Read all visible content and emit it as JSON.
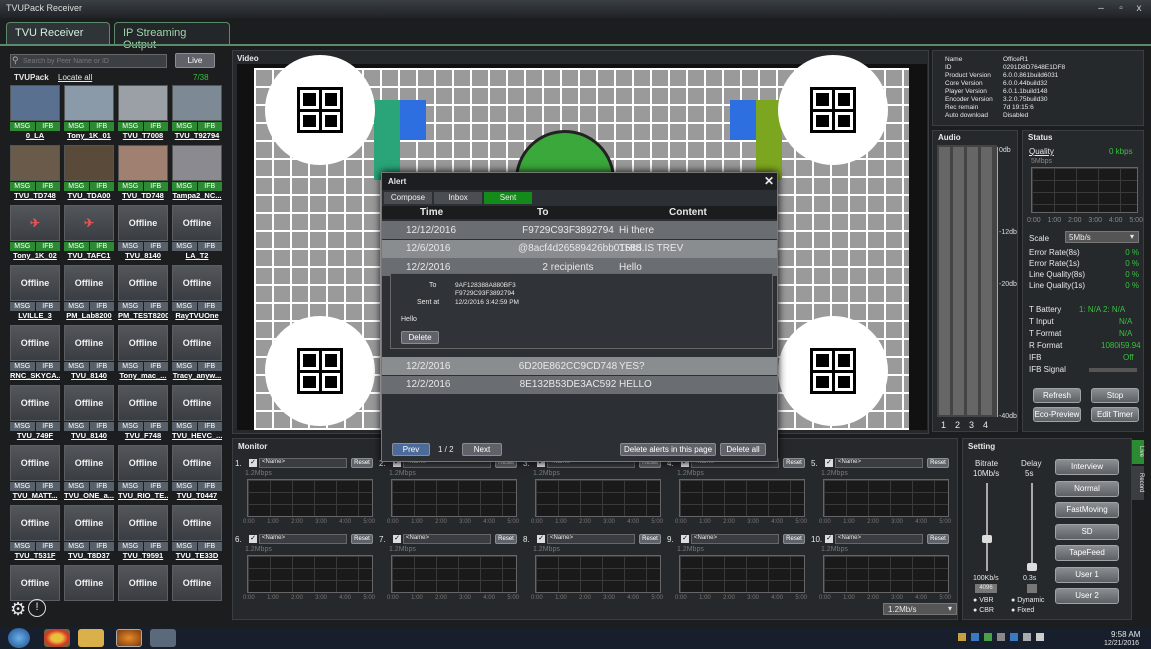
{
  "window": {
    "title": "TVUPack Receiver",
    "min": "–",
    "max": "▫",
    "close": "x"
  },
  "tabs": [
    {
      "label": "TVU Receiver"
    },
    {
      "label": "IP Streaming Output"
    }
  ],
  "sidebar": {
    "search_placeholder": "Search by Peer Name or ID",
    "live_label": "Live",
    "group": "TVUPack",
    "locate": "Locate all",
    "count": "7/38",
    "tiles": [
      {
        "name": "0_LA",
        "state": "video",
        "tags": "green"
      },
      {
        "name": "Tony_1K_01",
        "state": "video",
        "tags": "green"
      },
      {
        "name": "TVU_T7008",
        "state": "video",
        "tags": "green"
      },
      {
        "name": "TVU_T92794",
        "state": "video",
        "tags": "green"
      },
      {
        "name": "TVU_TD748",
        "state": "video",
        "tags": "green"
      },
      {
        "name": "TVU_TDA00",
        "state": "video",
        "tags": "green"
      },
      {
        "name": "TVU_TD748",
        "state": "video",
        "tags": "green"
      },
      {
        "name": "Tampa2_NC...",
        "state": "video",
        "tags": "green"
      },
      {
        "name": "Tony_1K_02",
        "state": "icon",
        "tags": "green"
      },
      {
        "name": "TVU_TAFC1",
        "state": "icon",
        "tags": "green"
      },
      {
        "name": "TVU_8140",
        "state": "Offline",
        "tags": "grey"
      },
      {
        "name": "LA_T2",
        "state": "Offline",
        "tags": "grey"
      },
      {
        "name": "LVILLE_3",
        "state": "Offline",
        "tags": "grey"
      },
      {
        "name": "PM_Lab8200",
        "state": "Offline",
        "tags": "grey"
      },
      {
        "name": "PM_TEST8200",
        "state": "Offline",
        "tags": "grey"
      },
      {
        "name": "RayTVUOne",
        "state": "Offline",
        "tags": "grey"
      },
      {
        "name": "RNC_SKYCA...",
        "state": "Offline",
        "tags": "grey"
      },
      {
        "name": "TVU_8140",
        "state": "Offline",
        "tags": "grey"
      },
      {
        "name": "Tony_mac_...",
        "state": "Offline",
        "tags": "grey"
      },
      {
        "name": "Tracy_anyw...",
        "state": "Offline",
        "tags": "grey"
      },
      {
        "name": "TVU_749F",
        "state": "Offline",
        "tags": "grey"
      },
      {
        "name": "TVU_8140",
        "state": "Offline",
        "tags": "grey"
      },
      {
        "name": "TVU_F748",
        "state": "Offline",
        "tags": "grey"
      },
      {
        "name": "TVU_HEVC_...",
        "state": "Offline",
        "tags": "grey"
      },
      {
        "name": "TVU_MATT...",
        "state": "Offline",
        "tags": "grey"
      },
      {
        "name": "TVU_ONE_a...",
        "state": "Offline",
        "tags": "grey"
      },
      {
        "name": "TVU_RIO_TE...",
        "state": "Offline",
        "tags": "grey"
      },
      {
        "name": "TVU_T0447",
        "state": "Offline",
        "tags": "grey"
      },
      {
        "name": "TVU_T531F",
        "state": "Offline",
        "tags": "grey"
      },
      {
        "name": "TVU_T8D37",
        "state": "Offline",
        "tags": "grey"
      },
      {
        "name": "TVU_T9591",
        "state": "Offline",
        "tags": "grey"
      },
      {
        "name": "TVU_TE33D",
        "state": "Offline",
        "tags": "grey"
      },
      {
        "name": "",
        "state": "Offline",
        "tags": "none"
      },
      {
        "name": "",
        "state": "Offline",
        "tags": "none"
      },
      {
        "name": "",
        "state": "Offline",
        "tags": "none"
      },
      {
        "name": "",
        "state": "Offline",
        "tags": "none"
      }
    ],
    "msg": "MSG",
    "ifb": "IFB",
    "offline": "Offline"
  },
  "video": {
    "label": "Video"
  },
  "info": {
    "rows": [
      [
        "Name",
        "OfficeR1"
      ],
      [
        "ID",
        "0291D8D7648E1DF8"
      ],
      [
        "Product Version",
        "6.0.0.861build6031"
      ],
      [
        "Core Version",
        "6.0.0.44build32"
      ],
      [
        "Player Version",
        "6.0.1.1build148"
      ],
      [
        "Encoder Version",
        "3.2.0.75build30"
      ],
      [
        "Rec remain",
        "7d 19:15:6"
      ],
      [
        "Auto download",
        "Disabled"
      ]
    ]
  },
  "audio": {
    "label": "Audio",
    "marks": [
      "0db",
      "-12db",
      "-20db",
      "-40db"
    ],
    "channels": [
      "1",
      "2",
      "3",
      "4"
    ]
  },
  "status": {
    "label": "Status",
    "quality": "Quality",
    "quality_val": "0 kbps",
    "ylabel": "5Mbps",
    "axis": [
      "0:00",
      "1:00",
      "2:00",
      "3:00",
      "4:00",
      "5:00"
    ],
    "scale": "Scale",
    "scale_val": "5Mb/s",
    "stats": [
      [
        "Error Rate(8s)",
        "0 %"
      ],
      [
        "Error Rate(1s)",
        "0 %"
      ],
      [
        "Line Quality(8s)",
        "0 %"
      ],
      [
        "Line Quality(1s)",
        "0 %"
      ]
    ],
    "battery": "T Battery",
    "battery_val": "1: N/A  2: N/A",
    "input": "T Input",
    "input_val": "N/A",
    "format": "T Format",
    "format_val": "N/A",
    "rformat": "R Format",
    "rformat_val": "1080i59.94",
    "ifb": "IFB",
    "ifb_val": "Off",
    "ifb_signal": "IFB Signal",
    "refresh": "Refresh",
    "stop": "Stop",
    "eco": "Eco-Preview",
    "edit": "Edit Timer"
  },
  "alert": {
    "title": "Alert",
    "tabs": [
      "Compose",
      "Inbox",
      "Sent"
    ],
    "headers": [
      "Time",
      "To",
      "Content"
    ],
    "rows": [
      [
        "12/12/2016",
        "F9729C93F3892794",
        "Hi there"
      ],
      [
        "12/6/2016",
        "@8acf4d26589426bb0158d...",
        "THIS IS TREV"
      ],
      [
        "12/2/2016",
        "2 recipients",
        "Hello"
      ]
    ],
    "detail": {
      "to_label": "To",
      "to": [
        "9AF128388A880BF3",
        "F9729C93F3892794"
      ],
      "sent_label": "Sent at",
      "sent": "12/2/2016 3:42:59 PM",
      "body": "Hello",
      "delete": "Delete"
    },
    "rows2": [
      [
        "12/2/2016",
        "6D20E862CC9CD748",
        "YES?"
      ],
      [
        "12/2/2016",
        "8E132B53DE3AC592",
        "HELLO"
      ]
    ],
    "prev": "Prev",
    "page": "1 / 2",
    "next": "Next",
    "del_page": "Delete alerts in this page",
    "del_all": "Delete all",
    "close": "✕"
  },
  "monitor": {
    "label": "Monitor",
    "slots": [
      "1.",
      "2.",
      "3.",
      "4.",
      "5.",
      "6.",
      "7.",
      "8.",
      "9.",
      "10."
    ],
    "name": "<Name>",
    "reset": "Reset",
    "ylabel": "1.2Mbps",
    "axis": [
      "0:00",
      "1:00",
      "2:00",
      "3:00",
      "4:00",
      "5:00"
    ],
    "bottom": "1.2Mb/s"
  },
  "setting": {
    "label": "Setting",
    "bitrate": "Bitrate",
    "bitrate_val": "10Mb/s",
    "delay": "Delay",
    "delay_val": "5s",
    "br_low": "100Kb/s",
    "br_box": "4096",
    "dl_low": "0.3s",
    "vbr": "VBR",
    "cbr": "CBR",
    "dynamic": "Dynamic",
    "fixed": "Fixed",
    "presets": [
      "Interview",
      "Normal",
      "FastMoving",
      "SD",
      "TapeFeed",
      "User 1",
      "User 2"
    ],
    "live": "Live",
    "record": "Record"
  },
  "taskbar": {
    "time": "9:58 AM",
    "date": "12/21/2016"
  }
}
